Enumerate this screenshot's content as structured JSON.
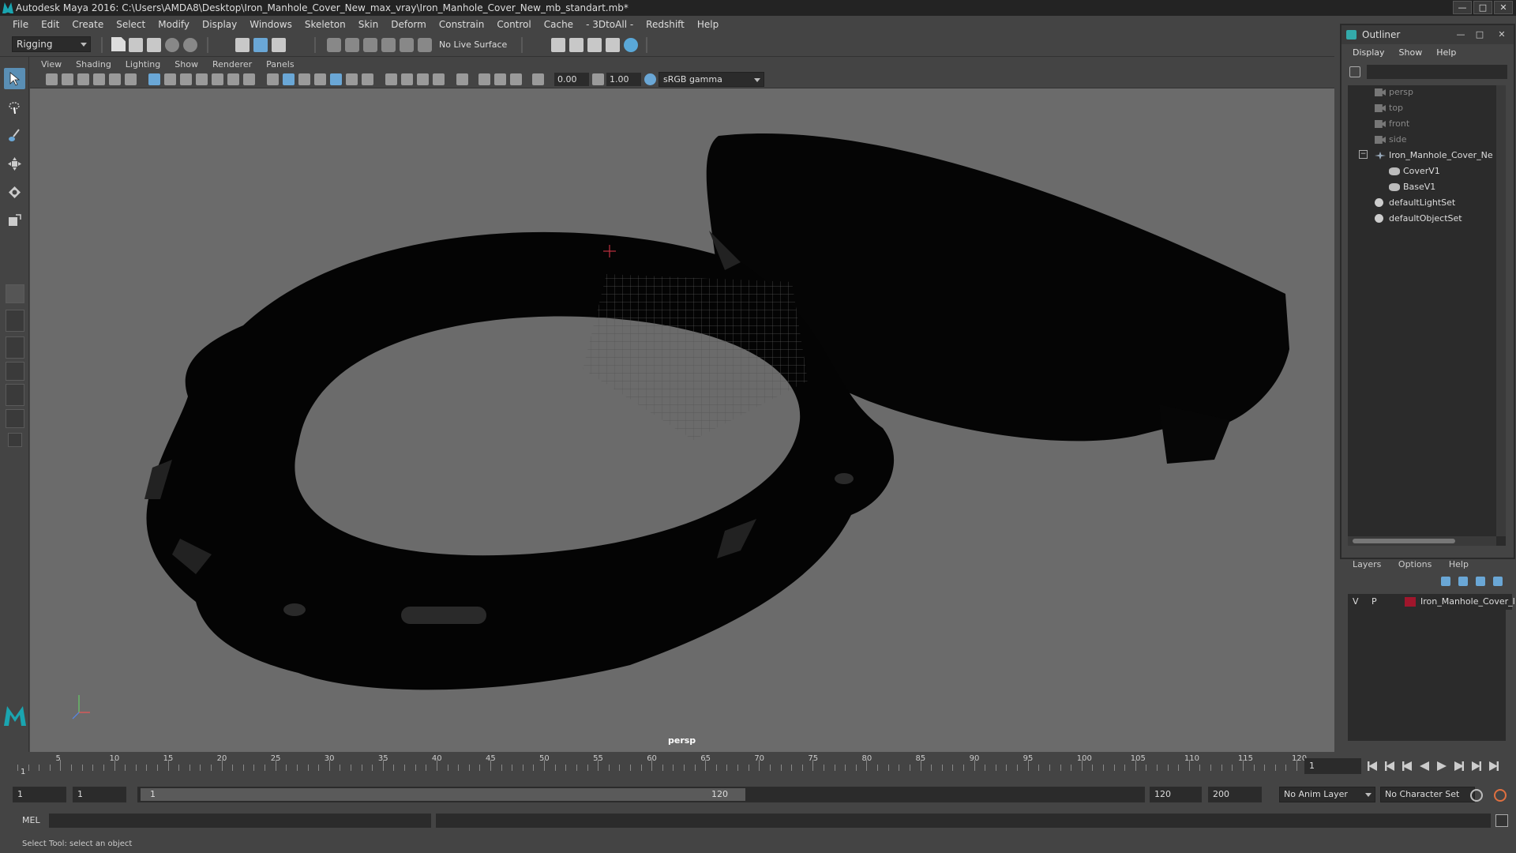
{
  "window": {
    "title": "Autodesk Maya 2016: C:\\Users\\AMDA8\\Desktop\\Iron_Manhole_Cover_New_max_vray\\Iron_Manhole_Cover_New_mb_standart.mb*",
    "minimize": "—",
    "maximize": "□",
    "close": "✕"
  },
  "menubar": [
    "File",
    "Edit",
    "Create",
    "Select",
    "Modify",
    "Display",
    "Windows",
    "Skeleton",
    "Skin",
    "Deform",
    "Constrain",
    "Control",
    "Cache",
    "- 3DtoAll -",
    "Redshift",
    "Help"
  ],
  "shelf": {
    "mode": "Rigging",
    "live_surface": "No Live Surface"
  },
  "viewport": {
    "menus": [
      "View",
      "Shading",
      "Lighting",
      "Show",
      "Renderer",
      "Panels"
    ],
    "exposure": "0.00",
    "gamma": "1.00",
    "color_space": "sRGB gamma",
    "camera_label": "persp"
  },
  "outliner": {
    "title": "Outliner",
    "menus": [
      "Display",
      "Show",
      "Help"
    ],
    "items": [
      {
        "label": "persp",
        "icon": "camera-icon"
      },
      {
        "label": "top",
        "icon": "camera-icon"
      },
      {
        "label": "front",
        "icon": "camera-icon"
      },
      {
        "label": "side",
        "icon": "camera-icon"
      },
      {
        "label": "Iron_Manhole_Cover_Ne",
        "icon": "group-icon"
      },
      {
        "label": "CoverV1",
        "icon": "mesh-icon"
      },
      {
        "label": "BaseV1",
        "icon": "mesh-icon"
      },
      {
        "label": "defaultLightSet",
        "icon": "set-icon"
      },
      {
        "label": "defaultObjectSet",
        "icon": "set-icon"
      }
    ],
    "collapse_symbol": "−"
  },
  "layers": {
    "menus": [
      "Layers",
      "Options",
      "Help"
    ],
    "row": {
      "v": "V",
      "p": "P",
      "name": "Iron_Manhole_Cover_I",
      "color": "#a0162c"
    }
  },
  "timeline": {
    "ticks": [
      "5",
      "10",
      "15",
      "20",
      "25",
      "30",
      "35",
      "40",
      "45",
      "50",
      "55",
      "60",
      "65",
      "70",
      "75",
      "80",
      "85",
      "90",
      "95",
      "100",
      "105",
      "110",
      "115",
      "120"
    ],
    "current_frame_marker": "1",
    "current_frame_field": "1"
  },
  "range": {
    "start": "1",
    "current": "1",
    "slider_start": "1",
    "slider_end": "120",
    "end": "120",
    "max": "200",
    "anim_layer": "No Anim Layer",
    "character_set": "No Character Set"
  },
  "command": {
    "lang": "MEL"
  },
  "status": {
    "help": "Select Tool: select an object"
  }
}
